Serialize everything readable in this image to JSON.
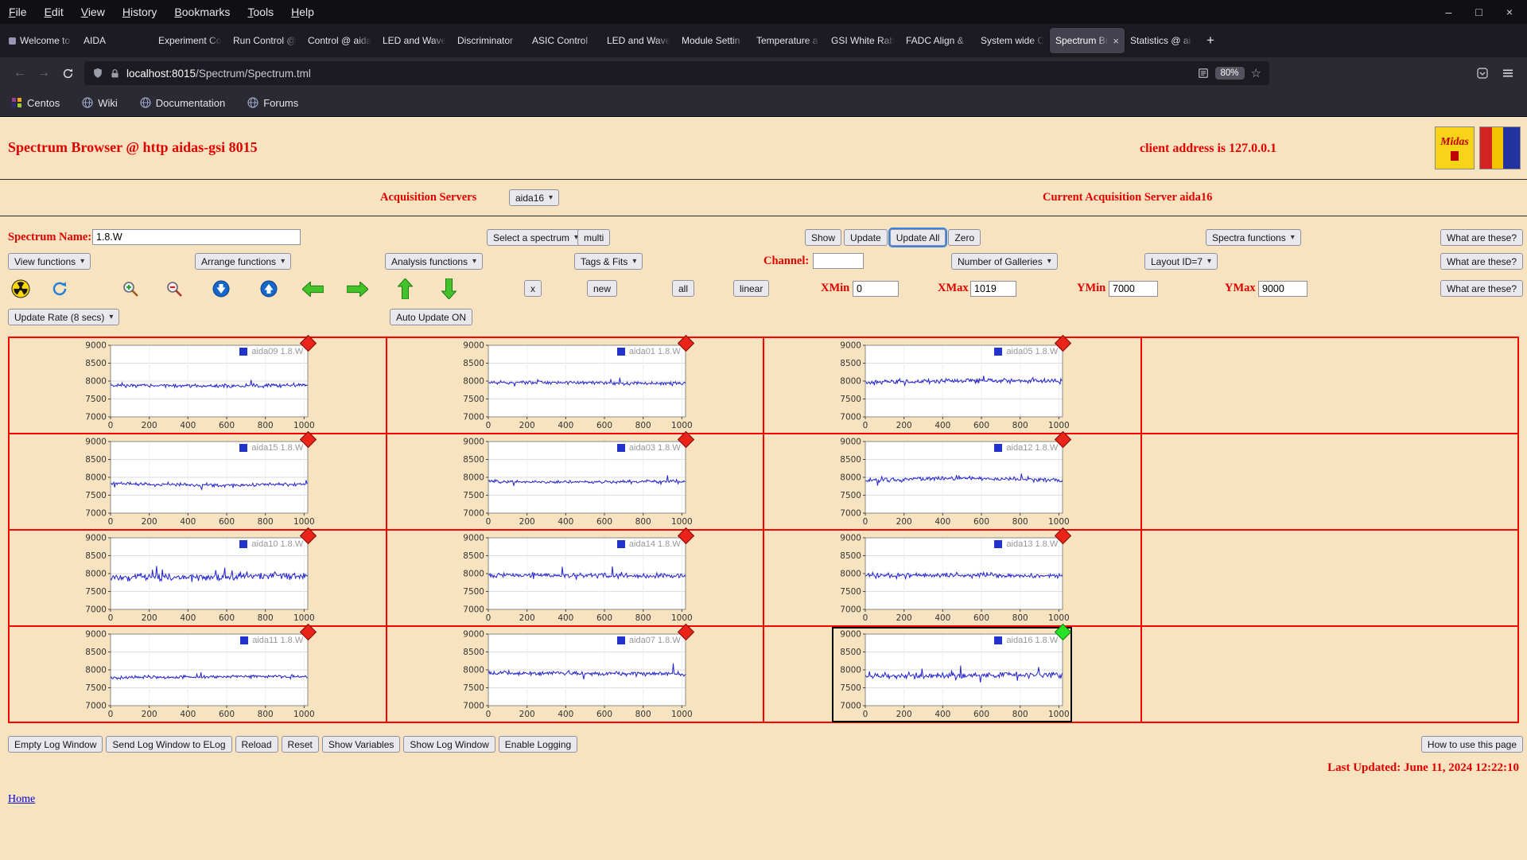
{
  "browser": {
    "menu": [
      "File",
      "Edit",
      "View",
      "History",
      "Bookmarks",
      "Tools",
      "Help"
    ],
    "tabs": [
      {
        "label": "Welcome to C",
        "favicon": true
      },
      {
        "label": "AIDA"
      },
      {
        "label": "Experiment Co"
      },
      {
        "label": "Run Control @"
      },
      {
        "label": "Control @ aida"
      },
      {
        "label": "LED and Wave"
      },
      {
        "label": "Discriminator"
      },
      {
        "label": "ASIC Control"
      },
      {
        "label": "LED and Wave"
      },
      {
        "label": "Module Settin"
      },
      {
        "label": "Temperature a"
      },
      {
        "label": "GSI White Rab"
      },
      {
        "label": "FADC Align &"
      },
      {
        "label": "System wide C"
      },
      {
        "label": "Spectrum Br",
        "active": true
      },
      {
        "label": "Statistics @ ai"
      }
    ],
    "new_tab": "+",
    "url": {
      "host": "localhost:8015",
      "path": "/Spectrum/Spectrum.tml"
    },
    "zoom": "80%",
    "bookmarks": [
      {
        "label": "Centos",
        "icon": "centos"
      },
      {
        "label": "Wiki",
        "icon": "globe"
      },
      {
        "label": "Documentation",
        "icon": "globe"
      },
      {
        "label": "Forums",
        "icon": "globe"
      }
    ]
  },
  "page": {
    "title": "Spectrum Browser @ http aidas-gsi 8015",
    "client_address": "client address is 127.0.0.1",
    "acquisition_servers_label": "Acquisition Servers",
    "acquisition_server_selected": "aida16",
    "current_server": "Current Acquisition Server aida16",
    "spectrum_name_label": "Spectrum Name:",
    "spectrum_name_value": "1.8.W",
    "select_spectrum": "Select a spectrum",
    "multi": "multi",
    "show": "Show",
    "update": "Update",
    "update_all": "Update All",
    "zero": "Zero",
    "spectra_functions": "Spectra functions",
    "what_are_these": "What are these?",
    "view_functions": "View functions",
    "arrange_functions": "Arrange functions",
    "analysis_functions": "Analysis functions",
    "tags_fits": "Tags & Fits",
    "channel_label": "Channel:",
    "channel_value": "",
    "number_of_galleries": "Number of Galleries",
    "layout_id": "Layout ID=7",
    "x_button": "x",
    "new_button": "new",
    "all_button": "all",
    "linear_button": "linear",
    "xmin_label": "XMin",
    "xmin": "0",
    "xmax_label": "XMax",
    "xmax": "1019",
    "ymin_label": "YMin",
    "ymin": "7000",
    "ymax_label": "YMax",
    "ymax": "9000",
    "update_rate": "Update Rate (8 secs)",
    "auto_update": "Auto Update ON",
    "log_buttons": [
      "Empty Log Window",
      "Send Log Window to ELog",
      "Reload",
      "Reset",
      "Show Variables",
      "Show Log Window",
      "Enable Logging"
    ],
    "how_to": "How to use this page",
    "last_updated": "Last Updated: June 11, 2024 12:22:10",
    "home": "Home",
    "midas_logo_text": "Midas"
  },
  "chart_data": {
    "type": "line",
    "title": "",
    "xlabel": "",
    "ylabel": "",
    "xlim": [
      0,
      1019
    ],
    "ylim": [
      7000,
      9000
    ],
    "x_ticks": [
      0,
      200,
      400,
      600,
      800,
      1000
    ],
    "y_ticks": [
      7000,
      7500,
      8000,
      8500,
      9000
    ],
    "grid": true,
    "legend_position": "top-right-inside",
    "line_color": "#2323cf",
    "layout": {
      "rows": 4,
      "cols": 4
    },
    "panels": [
      {
        "row": 0,
        "col": 0,
        "name": "aida09",
        "legend": "aida09 1.8.W",
        "baseline": 7880,
        "noise": 45,
        "spike_amp": 150,
        "spike_prob": 0.03,
        "drift": 15,
        "seed": 9,
        "marker": "red",
        "selected": false
      },
      {
        "row": 0,
        "col": 1,
        "name": "aida01",
        "legend": "aida01 1.8.W",
        "baseline": 7950,
        "noise": 45,
        "spike_amp": 120,
        "spike_prob": 0.02,
        "drift": 15,
        "seed": 1,
        "marker": "red",
        "selected": false
      },
      {
        "row": 0,
        "col": 2,
        "name": "aida05",
        "legend": "aida05 1.8.W",
        "baseline": 7990,
        "noise": 55,
        "spike_amp": 150,
        "spike_prob": 0.04,
        "drift": 25,
        "seed": 5,
        "marker": "red",
        "selected": false
      },
      {
        "row": 1,
        "col": 0,
        "name": "aida15",
        "legend": "aida15 1.8.W",
        "baseline": 7810,
        "noise": 40,
        "spike_amp": 120,
        "spike_prob": 0.02,
        "drift": 30,
        "seed": 15,
        "marker": "red",
        "selected": false
      },
      {
        "row": 1,
        "col": 1,
        "name": "aida03",
        "legend": "aida03 1.8.W",
        "baseline": 7880,
        "noise": 40,
        "spike_amp": 200,
        "spike_prob": 0.015,
        "drift": 10,
        "seed": 3,
        "marker": "red",
        "selected": false
      },
      {
        "row": 1,
        "col": 2,
        "name": "aida12",
        "legend": "aida12 1.8.W",
        "baseline": 7930,
        "noise": 50,
        "spike_amp": 140,
        "spike_prob": 0.03,
        "drift": 40,
        "seed": 12,
        "marker": "red",
        "selected": false
      },
      {
        "row": 2,
        "col": 0,
        "name": "aida10",
        "legend": "aida10 1.8.W",
        "baseline": 7920,
        "noise": 90,
        "spike_amp": 260,
        "spike_prob": 0.06,
        "drift": 20,
        "seed": 10,
        "marker": "red",
        "selected": false
      },
      {
        "row": 2,
        "col": 1,
        "name": "aida14",
        "legend": "aida14 1.8.W",
        "baseline": 7950,
        "noise": 60,
        "spike_amp": 220,
        "spike_prob": 0.04,
        "drift": 10,
        "seed": 14,
        "marker": "red",
        "selected": false
      },
      {
        "row": 2,
        "col": 2,
        "name": "aida13",
        "legend": "aida13 1.8.W",
        "baseline": 7950,
        "noise": 55,
        "spike_amp": 150,
        "spike_prob": 0.03,
        "drift": 15,
        "seed": 13,
        "marker": "red",
        "selected": false
      },
      {
        "row": 3,
        "col": 0,
        "name": "aida11",
        "legend": "aida11 1.8.W",
        "baseline": 7800,
        "noise": 40,
        "spike_amp": 130,
        "spike_prob": 0.02,
        "drift": 15,
        "seed": 11,
        "marker": "red",
        "selected": false
      },
      {
        "row": 3,
        "col": 1,
        "name": "aida07",
        "legend": "aida07 1.8.W",
        "baseline": 7900,
        "noise": 50,
        "spike_amp": 280,
        "spike_prob": 0.02,
        "drift": 10,
        "seed": 7,
        "marker": "red",
        "selected": false
      },
      {
        "row": 3,
        "col": 2,
        "name": "aida16",
        "legend": "aida16 1.8.W",
        "baseline": 7850,
        "noise": 70,
        "spike_amp": 220,
        "spike_prob": 0.05,
        "drift": 20,
        "seed": 16,
        "marker": "green",
        "selected": true
      }
    ]
  }
}
